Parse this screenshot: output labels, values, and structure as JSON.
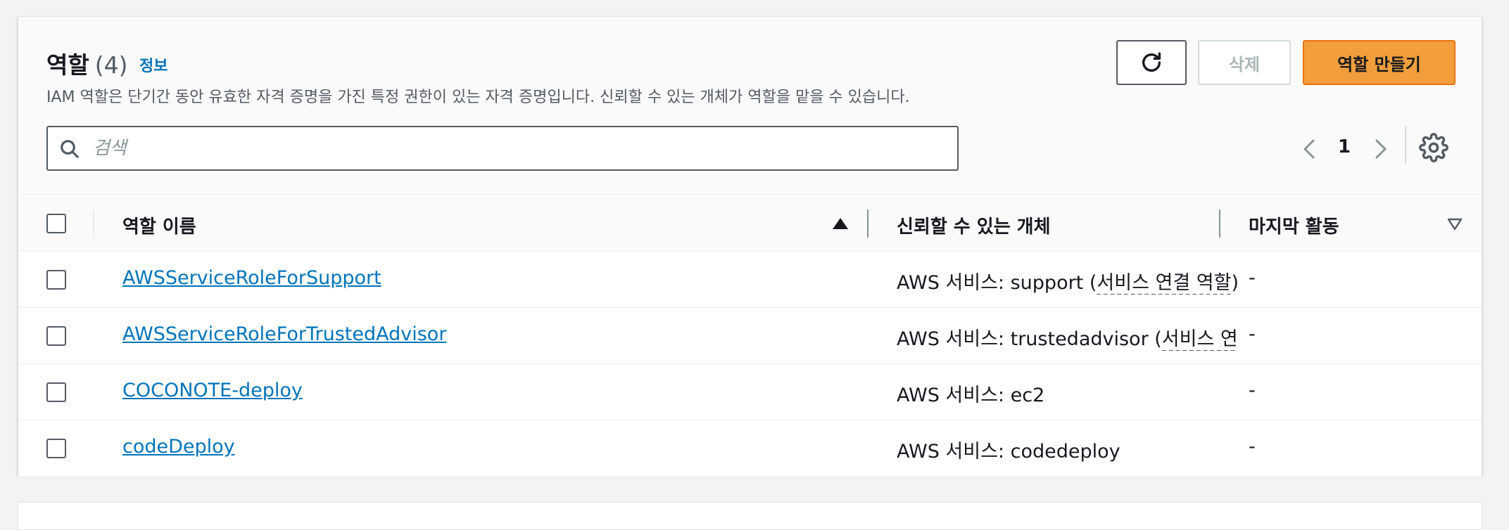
{
  "header": {
    "title": "역할",
    "count": "(4)",
    "info_link": "정보",
    "description": "IAM 역할은 단기간 동안 유효한 자격 증명을 가진 특정 권한이 있는 자격 증명입니다. 신뢰할 수 있는 개체가 역할을 맡을 수 있습니다."
  },
  "toolbar": {
    "refresh_icon": "refresh-icon",
    "delete_label": "삭제",
    "create_label": "역할 만들기"
  },
  "search": {
    "placeholder": "검색",
    "value": ""
  },
  "pagination": {
    "current_page": "1",
    "prev_icon": "chevron-left-icon",
    "next_icon": "chevron-right-icon",
    "settings_icon": "gear-icon"
  },
  "table": {
    "columns": {
      "name": "역할 이름",
      "trusted": "신뢰할 수 있는 개체",
      "last_activity": "마지막 활동"
    },
    "sort": {
      "name": "ascending",
      "last_activity": "descending"
    },
    "rows": [
      {
        "name": "AWSServiceRoleForSupport",
        "trusted_prefix": "AWS 서비스: support ",
        "trusted_paren_open": "(",
        "trusted_tag": "서비스 연결 역할",
        "trusted_paren_close": ")",
        "last_activity": "-"
      },
      {
        "name": "AWSServiceRoleForTrustedAdvisor",
        "trusted_prefix": "AWS 서비스: trustedadvisor ",
        "trusted_paren_open": "(",
        "trusted_tag": "서비스 연결 역할",
        "trusted_paren_close": ")",
        "last_activity": "-"
      },
      {
        "name": "COCONOTE-deploy",
        "trusted_prefix": "AWS 서비스: ec2",
        "trusted_paren_open": "",
        "trusted_tag": "",
        "trusted_paren_close": "",
        "last_activity": "-"
      },
      {
        "name": "codeDeploy",
        "trusted_prefix": "AWS 서비스: codedeploy",
        "trusted_paren_open": "",
        "trusted_tag": "",
        "trusted_paren_close": "",
        "last_activity": "-"
      }
    ]
  },
  "colors": {
    "link": "#0073bb",
    "primary_button": "#f29e3d",
    "text": "#16191f",
    "muted": "#545b64"
  }
}
